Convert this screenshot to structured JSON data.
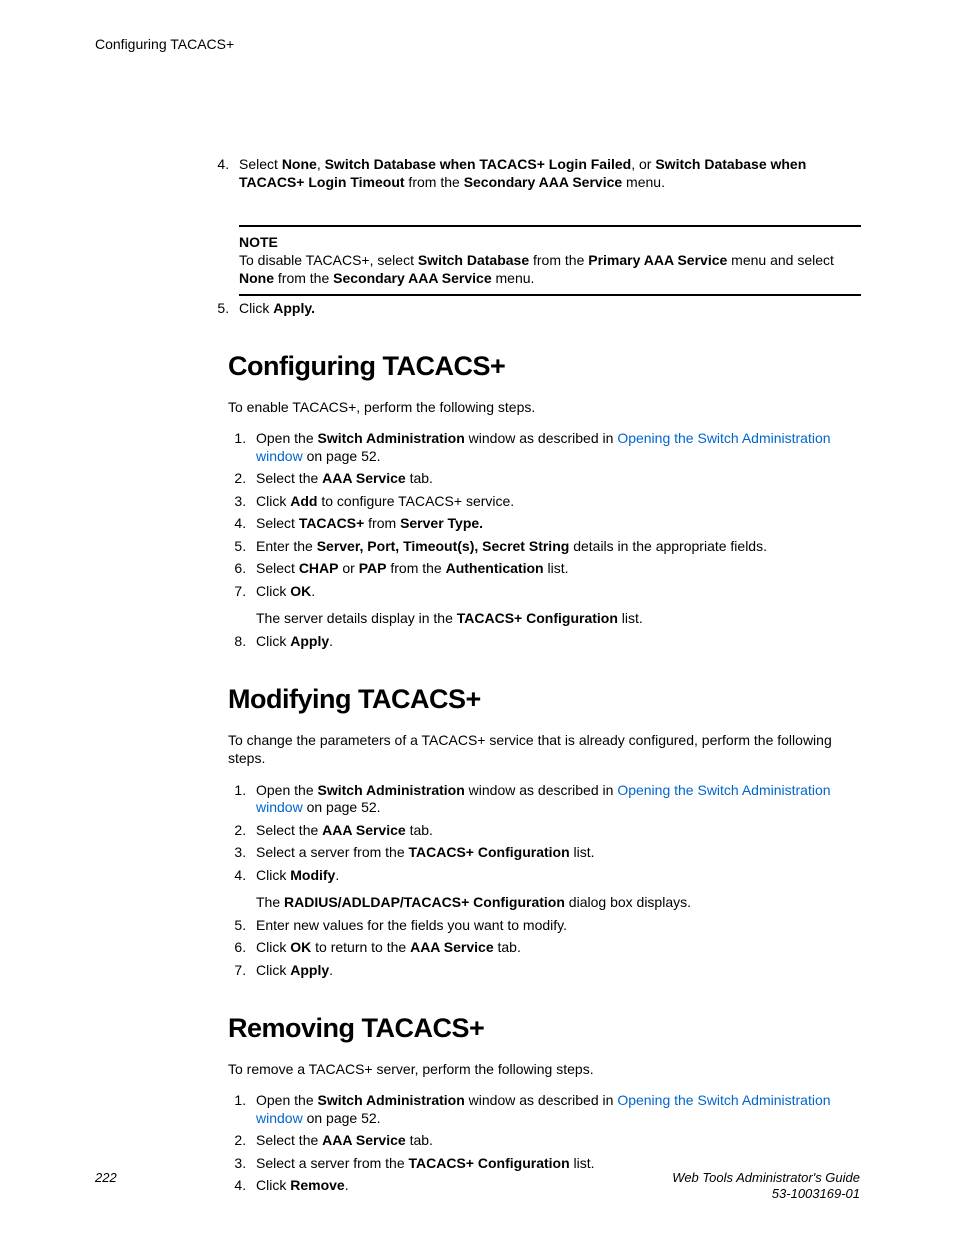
{
  "runningHeader": "Configuring TACACS+",
  "topSteps": {
    "start": 4,
    "items": [
      {
        "parts": [
          {
            "t": "plain",
            "v": "Select "
          },
          {
            "t": "b",
            "v": "None"
          },
          {
            "t": "plain",
            "v": ", "
          },
          {
            "t": "b",
            "v": "Switch Database when TACACS+ Login Failed"
          },
          {
            "t": "plain",
            "v": ", or "
          },
          {
            "t": "b",
            "v": "Switch Database when TACACS+ Login Timeout"
          },
          {
            "t": "plain",
            "v": " from the "
          },
          {
            "t": "b",
            "v": "Secondary AAA Service"
          },
          {
            "t": "plain",
            "v": " menu."
          }
        ]
      }
    ]
  },
  "note": {
    "label": "NOTE",
    "parts": [
      {
        "t": "plain",
        "v": "To disable TACACS+, select "
      },
      {
        "t": "b",
        "v": "Switch Database"
      },
      {
        "t": "plain",
        "v": " from the "
      },
      {
        "t": "b",
        "v": "Primary AAA Service"
      },
      {
        "t": "plain",
        "v": " menu and select "
      },
      {
        "t": "b",
        "v": "None"
      },
      {
        "t": "plain",
        "v": " from the "
      },
      {
        "t": "b",
        "v": "Secondary AAA Service"
      },
      {
        "t": "plain",
        "v": " menu."
      }
    ]
  },
  "afterNoteSteps": {
    "start": 5,
    "items": [
      {
        "parts": [
          {
            "t": "plain",
            "v": "Click "
          },
          {
            "t": "b",
            "v": "Apply."
          }
        ]
      }
    ]
  },
  "sections": [
    {
      "heading": "Configuring TACACS+",
      "intro": "To enable TACACS+, perform the following steps.",
      "start": 1,
      "items": [
        {
          "parts": [
            {
              "t": "plain",
              "v": "Open the "
            },
            {
              "t": "b",
              "v": "Switch Administration"
            },
            {
              "t": "plain",
              "v": " window as described in "
            },
            {
              "t": "a",
              "v": "Opening the Switch Administration window"
            },
            {
              "t": "plain",
              "v": " on page 52."
            }
          ]
        },
        {
          "parts": [
            {
              "t": "plain",
              "v": "Select the "
            },
            {
              "t": "b",
              "v": "AAA Service"
            },
            {
              "t": "plain",
              "v": " tab."
            }
          ]
        },
        {
          "parts": [
            {
              "t": "plain",
              "v": "Click "
            },
            {
              "t": "b",
              "v": "Add"
            },
            {
              "t": "plain",
              "v": " to configure TACACS+ service."
            }
          ]
        },
        {
          "parts": [
            {
              "t": "plain",
              "v": "Select "
            },
            {
              "t": "b",
              "v": "TACACS+"
            },
            {
              "t": "plain",
              "v": " from "
            },
            {
              "t": "b",
              "v": "Server Type."
            }
          ]
        },
        {
          "parts": [
            {
              "t": "plain",
              "v": "Enter the "
            },
            {
              "t": "b",
              "v": "Server, Port, Timeout(s), Secret String"
            },
            {
              "t": "plain",
              "v": " details in the appropriate fields."
            }
          ]
        },
        {
          "parts": [
            {
              "t": "plain",
              "v": "Select "
            },
            {
              "t": "b",
              "v": "CHAP"
            },
            {
              "t": "plain",
              "v": " or "
            },
            {
              "t": "b",
              "v": "PAP"
            },
            {
              "t": "plain",
              "v": " from the "
            },
            {
              "t": "b",
              "v": "Authentication"
            },
            {
              "t": "plain",
              "v": " list."
            }
          ]
        },
        {
          "parts": [
            {
              "t": "plain",
              "v": "Click "
            },
            {
              "t": "b",
              "v": "OK"
            },
            {
              "t": "plain",
              "v": "."
            }
          ],
          "sub": [
            {
              "t": "plain",
              "v": "The server details display in the "
            },
            {
              "t": "b",
              "v": "TACACS+ Configuration"
            },
            {
              "t": "plain",
              "v": " list."
            }
          ]
        },
        {
          "parts": [
            {
              "t": "plain",
              "v": "Click "
            },
            {
              "t": "b",
              "v": "Apply"
            },
            {
              "t": "plain",
              "v": "."
            }
          ]
        }
      ]
    },
    {
      "heading": "Modifying TACACS+",
      "intro": "To change the parameters of a TACACS+ service that is already configured, perform the following steps.",
      "start": 1,
      "items": [
        {
          "parts": [
            {
              "t": "plain",
              "v": "Open the "
            },
            {
              "t": "b",
              "v": "Switch Administration"
            },
            {
              "t": "plain",
              "v": " window as described in "
            },
            {
              "t": "a",
              "v": "Opening the Switch Administration window"
            },
            {
              "t": "plain",
              "v": " on page 52."
            }
          ]
        },
        {
          "parts": [
            {
              "t": "plain",
              "v": "Select the "
            },
            {
              "t": "b",
              "v": "AAA Service"
            },
            {
              "t": "plain",
              "v": " tab."
            }
          ]
        },
        {
          "parts": [
            {
              "t": "plain",
              "v": "Select a server from the "
            },
            {
              "t": "b",
              "v": "TACACS+ Configuration"
            },
            {
              "t": "plain",
              "v": " list."
            }
          ]
        },
        {
          "parts": [
            {
              "t": "plain",
              "v": "Click "
            },
            {
              "t": "b",
              "v": "Modify"
            },
            {
              "t": "plain",
              "v": "."
            }
          ],
          "sub": [
            {
              "t": "plain",
              "v": "The "
            },
            {
              "t": "b",
              "v": "RADIUS/ADLDAP/TACACS+ Configuration"
            },
            {
              "t": "plain",
              "v": " dialog box displays."
            }
          ]
        },
        {
          "parts": [
            {
              "t": "plain",
              "v": "Enter new values for the fields you want to modify."
            }
          ]
        },
        {
          "parts": [
            {
              "t": "plain",
              "v": "Click "
            },
            {
              "t": "b",
              "v": "OK"
            },
            {
              "t": "plain",
              "v": " to return to the "
            },
            {
              "t": "b",
              "v": "AAA Service"
            },
            {
              "t": "plain",
              "v": " tab."
            }
          ]
        },
        {
          "parts": [
            {
              "t": "plain",
              "v": "Click "
            },
            {
              "t": "b",
              "v": "Apply"
            },
            {
              "t": "plain",
              "v": "."
            }
          ]
        }
      ]
    },
    {
      "heading": "Removing TACACS+",
      "intro": "To remove a TACACS+ server, perform the following steps.",
      "start": 1,
      "items": [
        {
          "parts": [
            {
              "t": "plain",
              "v": "Open the "
            },
            {
              "t": "b",
              "v": "Switch Administration"
            },
            {
              "t": "plain",
              "v": " window as described in "
            },
            {
              "t": "a",
              "v": "Opening the Switch Administration window"
            },
            {
              "t": "plain",
              "v": " on page 52."
            }
          ]
        },
        {
          "parts": [
            {
              "t": "plain",
              "v": "Select the "
            },
            {
              "t": "b",
              "v": "AAA Service"
            },
            {
              "t": "plain",
              "v": " tab."
            }
          ]
        },
        {
          "parts": [
            {
              "t": "plain",
              "v": "Select a server from the "
            },
            {
              "t": "b",
              "v": "TACACS+ Configuration"
            },
            {
              "t": "plain",
              "v": " list."
            }
          ]
        },
        {
          "parts": [
            {
              "t": "plain",
              "v": "Click "
            },
            {
              "t": "b",
              "v": "Remove"
            },
            {
              "t": "plain",
              "v": "."
            }
          ]
        }
      ]
    }
  ],
  "footer": {
    "pageNumber": "222",
    "docTitle": "Web Tools Administrator's Guide",
    "docId": "53-1003169-01"
  }
}
